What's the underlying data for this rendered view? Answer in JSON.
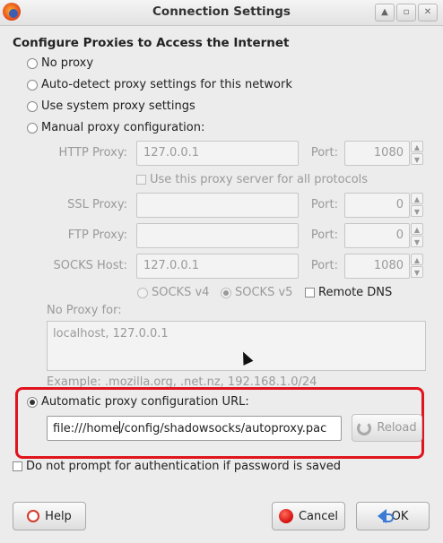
{
  "window": {
    "title": "Connection Settings",
    "controls": [
      "up-icon",
      "restore-icon",
      "close-icon"
    ]
  },
  "heading": "Configure Proxies to Access the Internet",
  "proxy_modes": {
    "no_proxy": "No proxy",
    "auto_detect": "Auto-detect proxy settings for this network",
    "system": "Use system proxy settings",
    "manual": "Manual proxy configuration:",
    "selected": "automatic_url"
  },
  "manual": {
    "http_label": "HTTP Proxy:",
    "http_value": "127.0.0.1",
    "http_port_label": "Port:",
    "http_port": "1080",
    "use_for_all": "Use this proxy server for all protocols",
    "ssl_label": "SSL Proxy:",
    "ssl_value": "",
    "ssl_port_label": "Port:",
    "ssl_port": "0",
    "ftp_label": "FTP Proxy:",
    "ftp_value": "",
    "ftp_port_label": "Port:",
    "ftp_port": "0",
    "socks_label": "SOCKS Host:",
    "socks_value": "127.0.0.1",
    "socks_port_label": "Port:",
    "socks_port": "1080",
    "socks_v4": "SOCKS v4",
    "socks_v5": "SOCKS v5",
    "remote_dns": "Remote DNS"
  },
  "no_proxy_for": {
    "label": "No Proxy for:",
    "value": "localhost, 127.0.0.1",
    "example": "Example: .mozilla.org, .net.nz, 192.168.1.0/24"
  },
  "auto_url": {
    "label": "Automatic proxy configuration URL:",
    "value_before_caret": "file:///home",
    "value_after_caret": "/config/shadowsocks/autoproxy.pac",
    "reload_label": "Reload"
  },
  "no_auth_prompt": "Do not prompt for authentication if password is saved",
  "buttons": {
    "help": "Help",
    "cancel": "Cancel",
    "ok": "OK"
  },
  "colors": {
    "highlight_frame": "#e0141d"
  }
}
